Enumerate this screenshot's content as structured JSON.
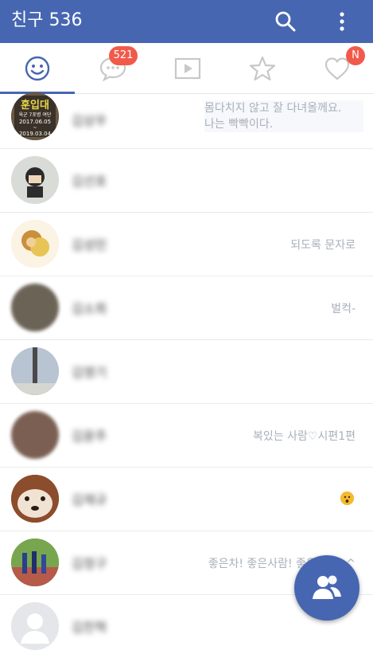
{
  "appbar": {
    "title": "친구 536",
    "search_icon": "search-icon",
    "more_icon": "more-vert-icon",
    "bg": "#4766b2"
  },
  "tabs": [
    {
      "name": "friends",
      "icon": "smiley-icon",
      "active": true
    },
    {
      "name": "chats",
      "icon": "chat-bubble-icon",
      "badge": "521"
    },
    {
      "name": "video",
      "icon": "play-icon"
    },
    {
      "name": "favorites",
      "icon": "star-icon"
    },
    {
      "name": "likes",
      "icon": "heart-icon",
      "badge": "N"
    }
  ],
  "friends": [
    {
      "name": "김상우",
      "status": "몸다치지 않고 잘 다녀올께요.\n나는 빡빡이다.",
      "avatar_color": "#5a4a3a",
      "avatar_text": "훈입대\n육군 7포병 여단\n2017.06.05\n~\n2019.03.04"
    },
    {
      "name": "김선호",
      "status": "",
      "avatar_color": "#d9dcd6"
    },
    {
      "name": "김성민",
      "status": "되도록 문자로",
      "avatar_color": "#c99a45"
    },
    {
      "name": "김소희",
      "status": "벌컥-",
      "avatar_color": "#6b6356"
    },
    {
      "name": "김영기",
      "status": "",
      "avatar_color": "#a7b3c2"
    },
    {
      "name": "김윤주",
      "status": "복있는 사람♡시편1편",
      "avatar_color": "#7b5f53"
    },
    {
      "name": "김재규",
      "status": "",
      "emoji": "face-surprised-emoji",
      "avatar_color": "#b0623c"
    },
    {
      "name": "김정구",
      "status": "좋은차! 좋은사람! 좋은여행^^",
      "avatar_color": "#5c8a4a"
    },
    {
      "name": "김찬혁",
      "status": "",
      "avatar_color": "#e4e6ea"
    }
  ],
  "fab": {
    "icon": "add-friend-icon"
  }
}
